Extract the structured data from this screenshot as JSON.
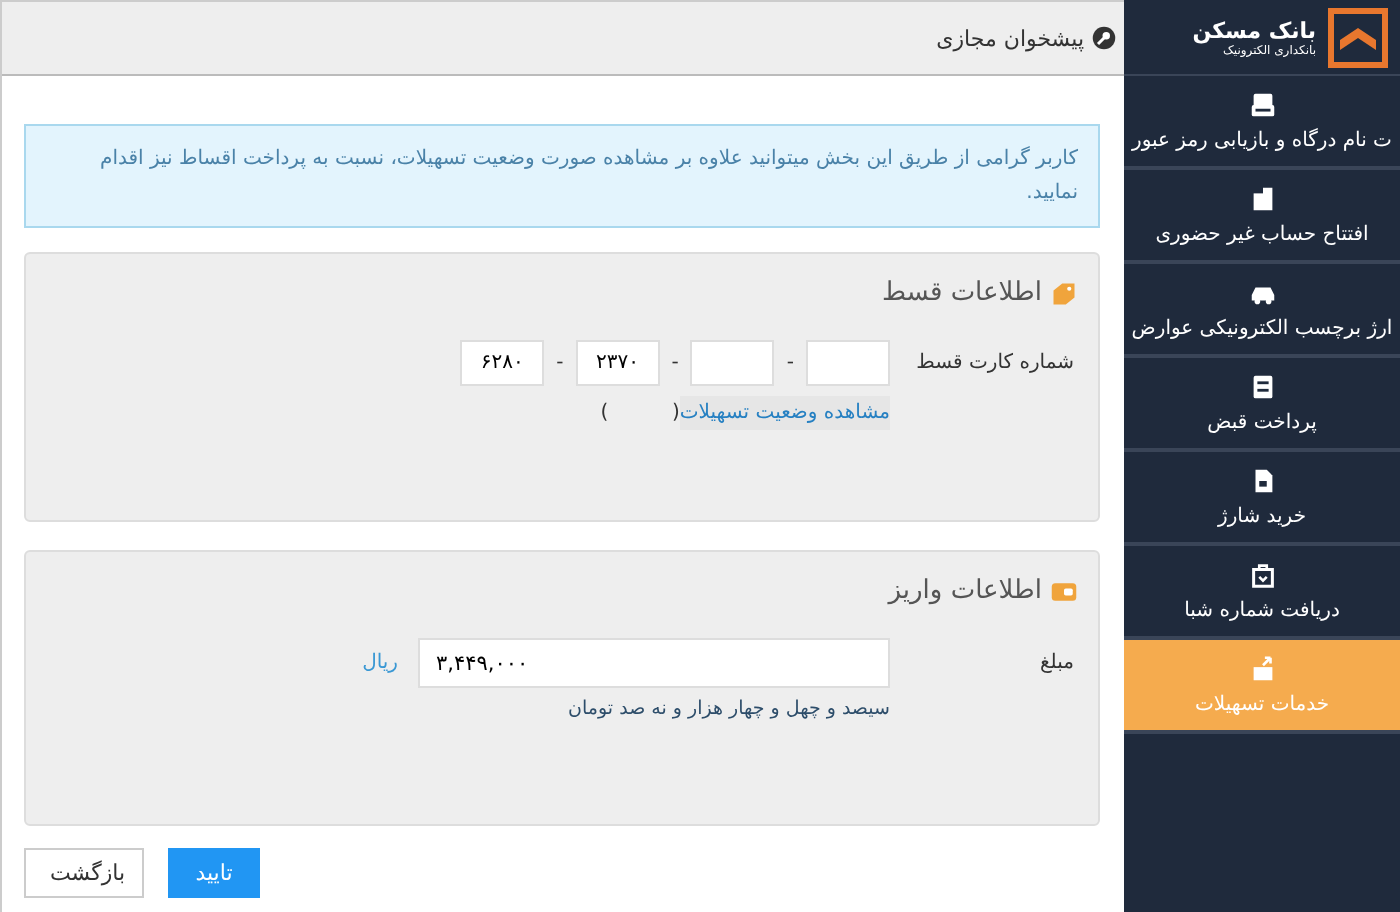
{
  "sidebar": {
    "logo": {
      "title": "بانک مسکن",
      "subtitle": "بانکداری الکترونیک"
    },
    "items": [
      {
        "label": "ت نام درگاه و بازیابی رمز عبور",
        "selected": false
      },
      {
        "label": "افتتاح حساب غیر حضوری",
        "selected": false
      },
      {
        "label": "ارژ برچسب الکترونیکی عوارض",
        "selected": false
      },
      {
        "label": "پرداخت قبض",
        "selected": false
      },
      {
        "label": "خرید شارژ",
        "selected": false
      },
      {
        "label": "دریافت شماره شبا",
        "selected": false
      },
      {
        "label": "خدمات تسهیلات",
        "selected": true
      }
    ]
  },
  "header": {
    "title": "پیشخوان مجازی"
  },
  "alert": {
    "text": "کاربر گرامی از طریق این بخش میتوانید علاوه بر مشاهده صورت وضعیت تسهیلات، نسبت به پرداخت اقساط نیز اقدام نمایید."
  },
  "panels": [
    {
      "title": "اطلاعات قسط",
      "label": "شماره کارت قسط",
      "card_fields": [
        {
          "separator": "-"
        },
        {
          "separator": "-"
        },
        {
          "value": "۲۳۷۰",
          "separator": "-"
        },
        {
          "value": "۶۲۸۰"
        }
      ],
      "link": "مشاهده وضعیت تسهیلات",
      "note": "(          )"
    },
    {
      "title": "اطلاعات واریز",
      "label": "مبلغ",
      "amount": "۳,۴۴۹,۰۰۰",
      "unit": "ریال",
      "amount_words": "سیصد و چهل و چهار هزار و نه صد تومان"
    }
  ],
  "buttons": [
    {
      "label": "تایید",
      "kind": "primary"
    },
    {
      "label": "بازگشت",
      "kind": "default"
    }
  ]
}
